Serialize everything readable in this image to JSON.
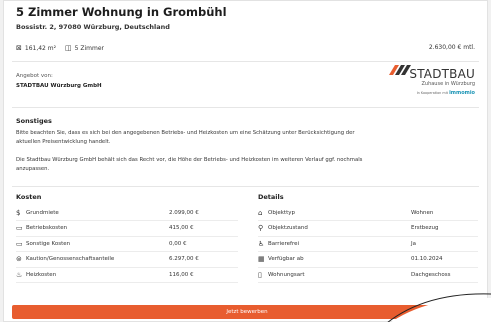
{
  "listing": {
    "title": "5 Zimmer Wohnung in Grombühl",
    "address": "Bossistr. 2, 97080 Würzburg, Deutschland",
    "area": "161,42 m²",
    "rooms": "5 Zimmer",
    "price": "2.630,00 € mtl."
  },
  "offer": {
    "label": "Angebot von:",
    "company": "STADTBAU Würzburg GmbH"
  },
  "logo": {
    "name": "STADTBAU",
    "subtitle": "Zuhause in Würzburg",
    "partner_text": "In Kooperation mit",
    "partner_name": "immomio"
  },
  "sonstiges": {
    "title": "Sonstiges",
    "paragraph1": "Bitte beachten Sie, dass es sich bei den angegebenen Betriebs- und Heizkosten um eine Schätzung unter Berücksichtigung der aktuellen Preisentwicklung handelt.",
    "paragraph2": "Die Stadtbau Würzburg GmbH behält sich das Recht vor, die Höhe der Betriebs- und Heizkosten im weiteren Verlauf ggf. nochmals anzupassen."
  },
  "kosten": {
    "title": "Kosten",
    "rows": [
      {
        "icon": "dollar-icon",
        "label": "Grundmiete",
        "value": "2.099,00 €"
      },
      {
        "icon": "money-icon",
        "label": "Betriebskosten",
        "value": "415,00 €"
      },
      {
        "icon": "money-icon",
        "label": "Sonstige Kosten",
        "value": "0,00 €"
      },
      {
        "icon": "safe-icon",
        "label": "Kaution/Genossenschaftsanteile",
        "value": "6.297,00 €"
      },
      {
        "icon": "flame-icon",
        "label": "Heizkosten",
        "value": "116,00 €"
      }
    ]
  },
  "details": {
    "title": "Details",
    "rows": [
      {
        "icon": "home-icon",
        "label": "Objekttyp",
        "value": "Wohnen"
      },
      {
        "icon": "paint-roller-icon",
        "label": "Objektzustand",
        "value": "Erstbezug"
      },
      {
        "icon": "wheelchair-icon",
        "label": "Barrierefrei",
        "value": "Ja"
      },
      {
        "icon": "calendar-icon",
        "label": "Verfügbar ab",
        "value": "01.10.2024"
      },
      {
        "icon": "building-icon",
        "label": "Wohnungsart",
        "value": "Dachgeschoss"
      }
    ]
  },
  "cta": {
    "label": "Jetzt bewerben",
    "color": "#e85d2f"
  }
}
